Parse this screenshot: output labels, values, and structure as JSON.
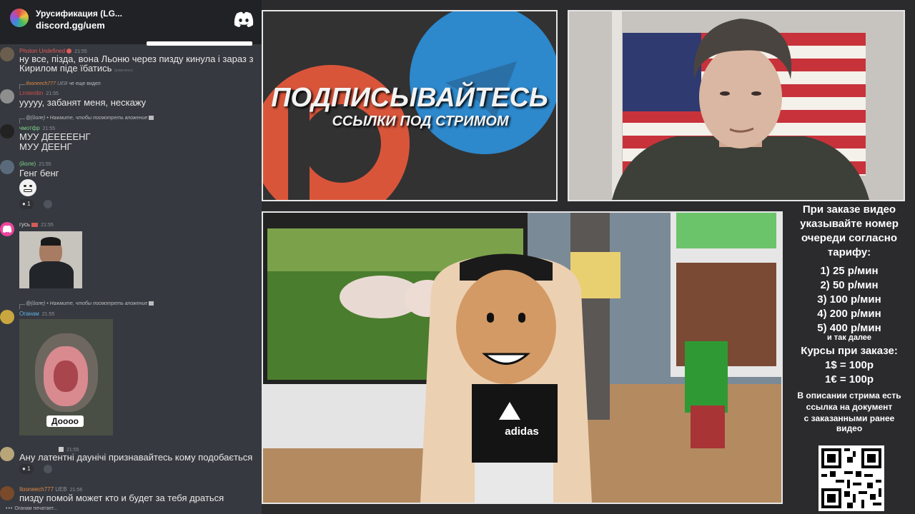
{
  "server": {
    "name": "Урусификация (LG...",
    "invite": "discord.gg/uem"
  },
  "messages": {
    "m1": {
      "user": "Photon Undefined",
      "time": "21:55",
      "line1": "ну все, пізда, вона Льоню через пизду кинула і зараз з",
      "line2": "Кирилом піде їбатись",
      "edited": "(изменено)"
    },
    "m2": {
      "reply_user": "Ilooneech777",
      "reply_badge": "UEB",
      "reply_text": "че еще видел",
      "user": "Lrntenibn",
      "time": "21:55",
      "text": "уууyy, забанят меня, нескажу"
    },
    "m3": {
      "reply_user": "@(йоле)",
      "reply_text": "Нажмите, чтобы посмотреть вложение",
      "user": "чмотфр",
      "time": "21:55",
      "line1": "МУУ ДЕЕЕЕЕНГ",
      "line2": "МУУ ДЕЕНГ"
    },
    "m4": {
      "user": "(йоле)",
      "time": "21:55",
      "text": "Генг бенг",
      "react_count": "1"
    },
    "m5": {
      "user": "гусь",
      "time": "21:55"
    },
    "m6": {
      "reply_user": "@(йоле)",
      "reply_text": "Нажмите, чтобы посмотреть вложение",
      "user": "Оганам",
      "time": "21:55",
      "image_caption": "Доооо"
    },
    "m7": {
      "time": "21:55",
      "text": "Ану латентні даунічі признавайтесь кому подобається",
      "react_count": "1"
    },
    "m8": {
      "user": "Ilooneech777",
      "badge": "UEB",
      "time": "21:56",
      "text": "пизду помой может  кто и будет за тебя драться"
    }
  },
  "typing": "Оганам печатает...",
  "promo": {
    "title": "ПОДПИСЫВАЙТЕСЬ",
    "subtitle": "ССЫЛКИ ПОД СТРИМОМ"
  },
  "game": {
    "shirt_text": "adidas"
  },
  "sidebar": {
    "lines": [
      "При заказе видео",
      "указывайте номер",
      "очереди согласно",
      "тарифу:"
    ],
    "tariffs": [
      "1) 25 р/мин",
      "2) 50 р/мин",
      "3) 100 р/мин",
      "4) 200 р/мин",
      "5) 400 р/мин"
    ],
    "etc": "и так далее",
    "courses_title": "Курсы при заказе:",
    "courses": [
      "1$ = 100р",
      "1€ = 100р"
    ],
    "desc": [
      "В описании стрима есть",
      "ссылка на документ",
      "с заказанными ранее",
      "видео"
    ]
  },
  "colors": {
    "chat_bg": "#36393f",
    "discord_blurple": "#5865f2",
    "telegram": "#2f8ed3",
    "patreon": "#e05a3a"
  }
}
